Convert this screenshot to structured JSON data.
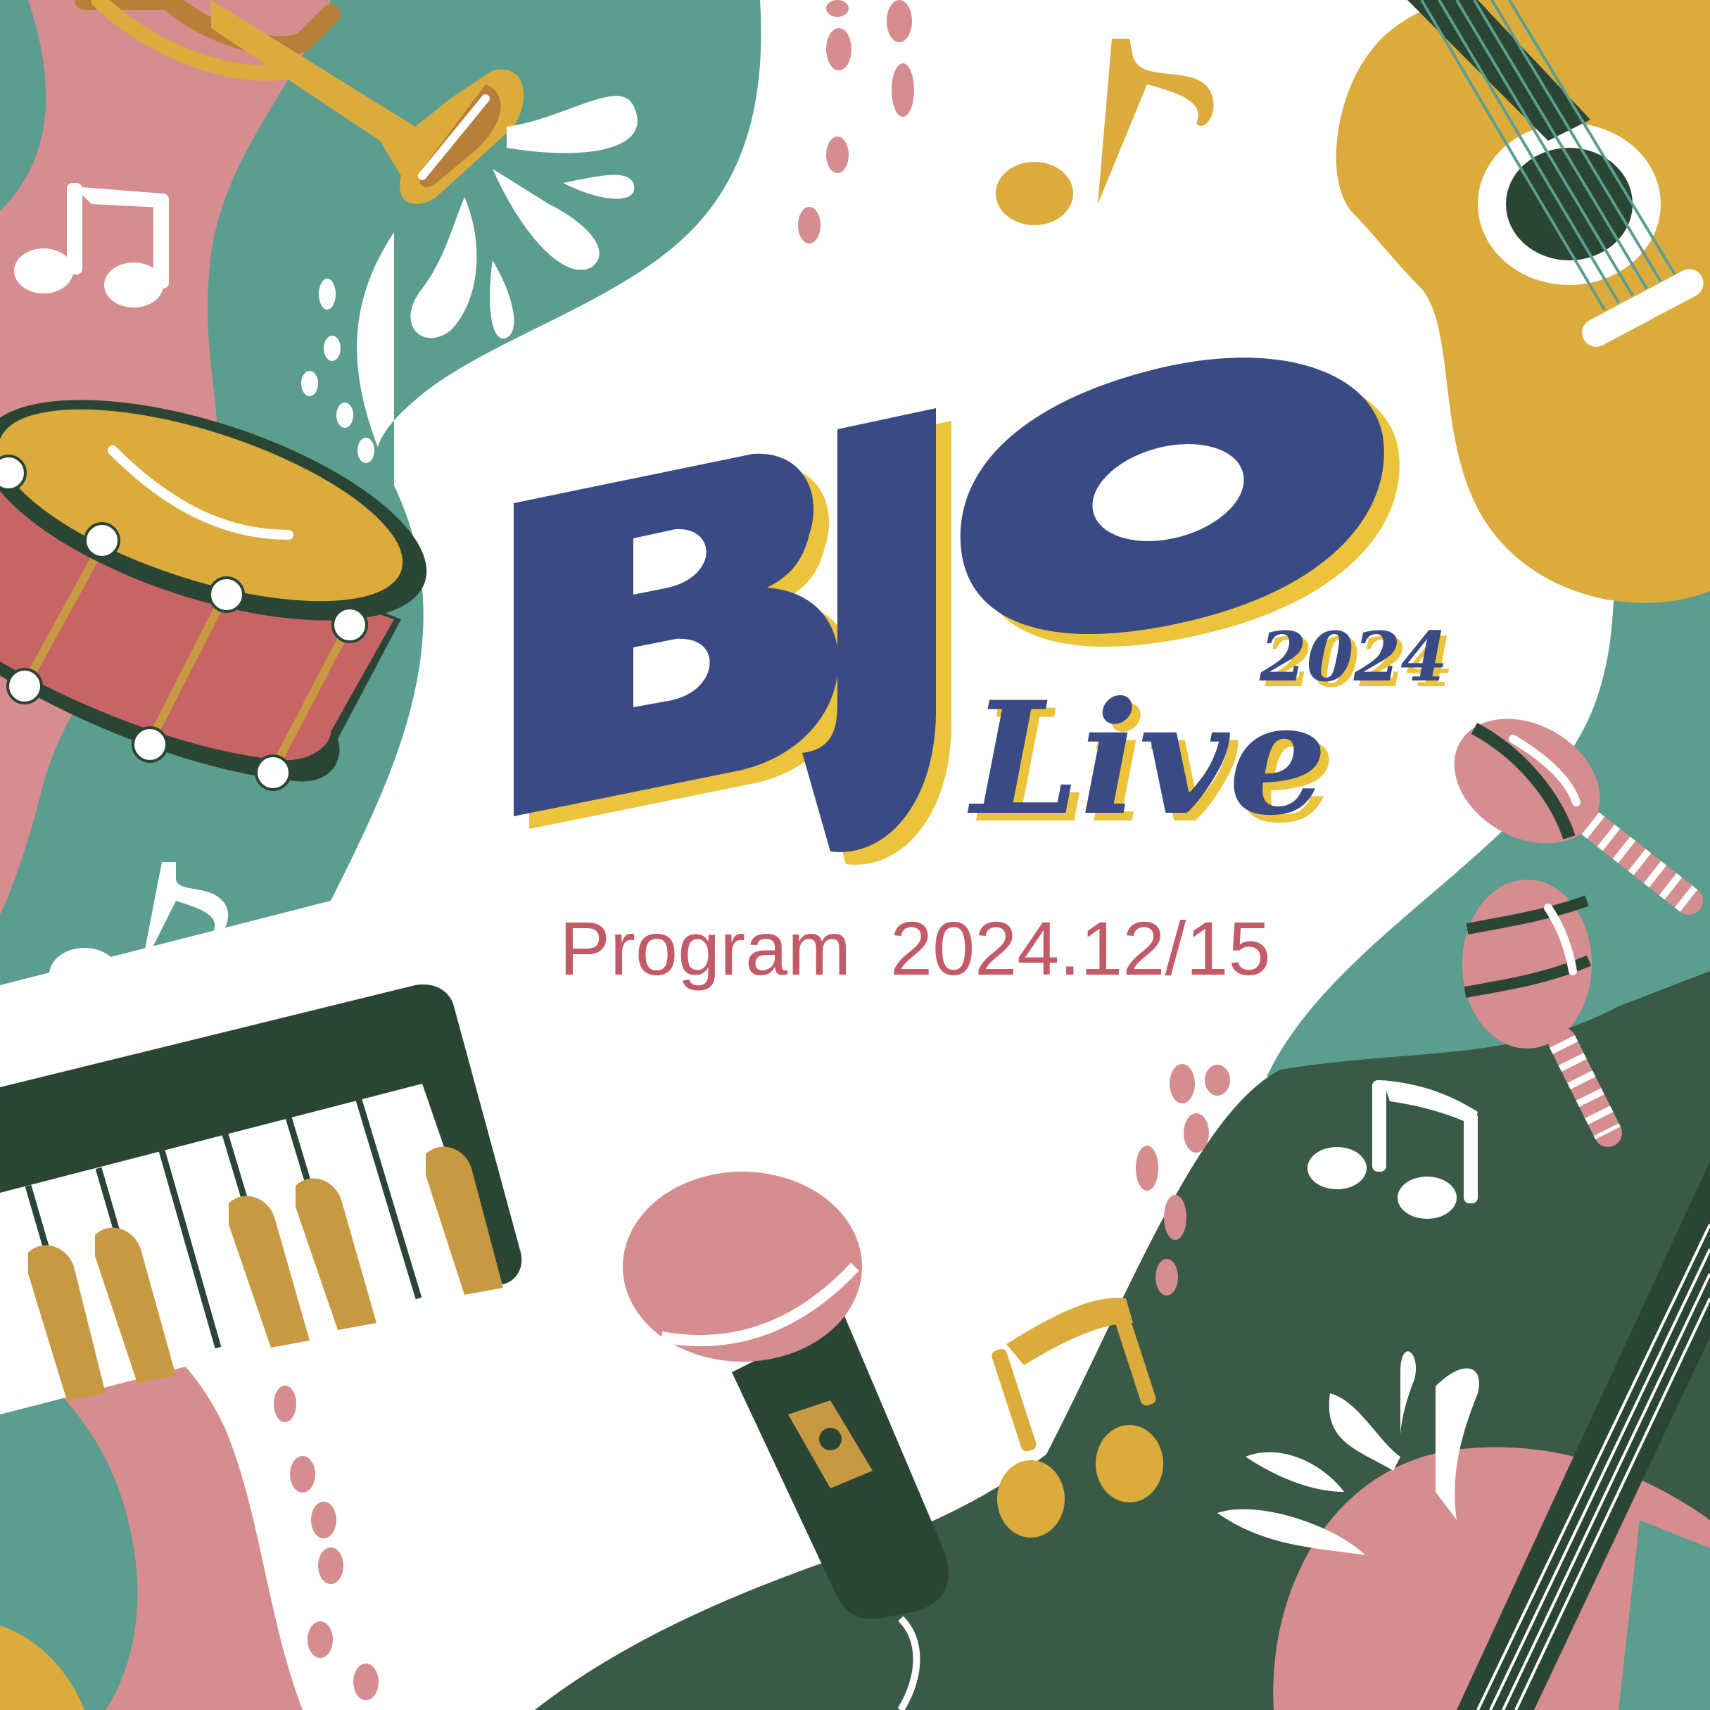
{
  "brand": {
    "logo_text": "BJO",
    "subtitle": "Live",
    "year": "2024"
  },
  "program": {
    "label": "Program",
    "date": "2024.12/15"
  },
  "colors": {
    "navy": "#394a85",
    "yellow": "#ecc43c",
    "pink": "#d58d90",
    "teal": "#5b9d8f",
    "dark_green": "#2b4535",
    "mid_green": "#385a47",
    "mustard": "#dbab3c",
    "drum_red": "#c66466",
    "program_text": "#c35a67"
  },
  "illustrations": [
    "trumpet-icon",
    "acoustic-guitar-icon",
    "snare-drum-icon",
    "maracas-icon",
    "keyboard-icon",
    "microphone-icon",
    "electric-guitar-icon",
    "music-note-icon"
  ]
}
